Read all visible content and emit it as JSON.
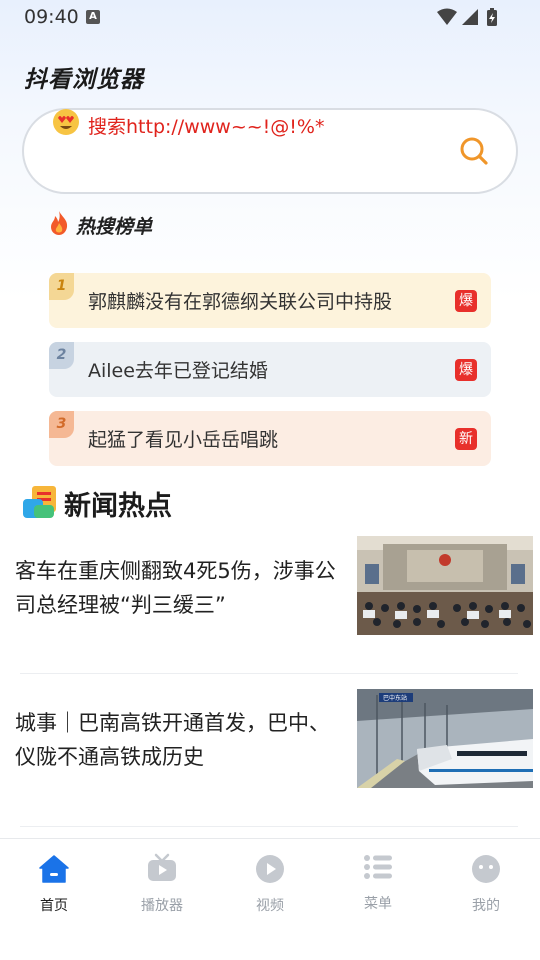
{
  "status_bar": {
    "time": "09:40",
    "badge": "A"
  },
  "app": {
    "title": "抖看浏览器"
  },
  "search": {
    "placeholder": "搜索http://www~~!@!%*"
  },
  "hot_list": {
    "title": "热搜榜单",
    "items": [
      {
        "rank": "1",
        "text": "郭麒麟没有在郭德纲关联公司中持股",
        "tag": "爆"
      },
      {
        "rank": "2",
        "text": "Ailee去年已登记结婚",
        "tag": "爆"
      },
      {
        "rank": "3",
        "text": "起猛了看见小岳岳唱跳",
        "tag": "新"
      }
    ]
  },
  "news": {
    "title": "新闻热点",
    "items": [
      {
        "text": "客车在重庆侧翻致4死5伤，涉事公司总经理被“判三缓三”",
        "thumb_sign": ""
      },
      {
        "text": "城事｜巴南高铁开通首发，巴中、仪陇不通高铁成历史",
        "thumb_sign": "巴中东站"
      }
    ]
  },
  "bottom_nav": {
    "items": [
      {
        "label": "首页",
        "icon": "home-icon",
        "active": true
      },
      {
        "label": "播放器",
        "icon": "tv-icon",
        "active": false
      },
      {
        "label": "视频",
        "icon": "play-icon",
        "active": false
      },
      {
        "label": "菜单",
        "icon": "menu-list-icon",
        "active": false
      },
      {
        "label": "我的",
        "icon": "profile-icon",
        "active": false
      }
    ]
  },
  "colors": {
    "accent_blue": "#1a73e8",
    "search_orange": "#f0962a",
    "hot_tag_red": "#e8302b",
    "placeholder_red": "#e0231c"
  }
}
